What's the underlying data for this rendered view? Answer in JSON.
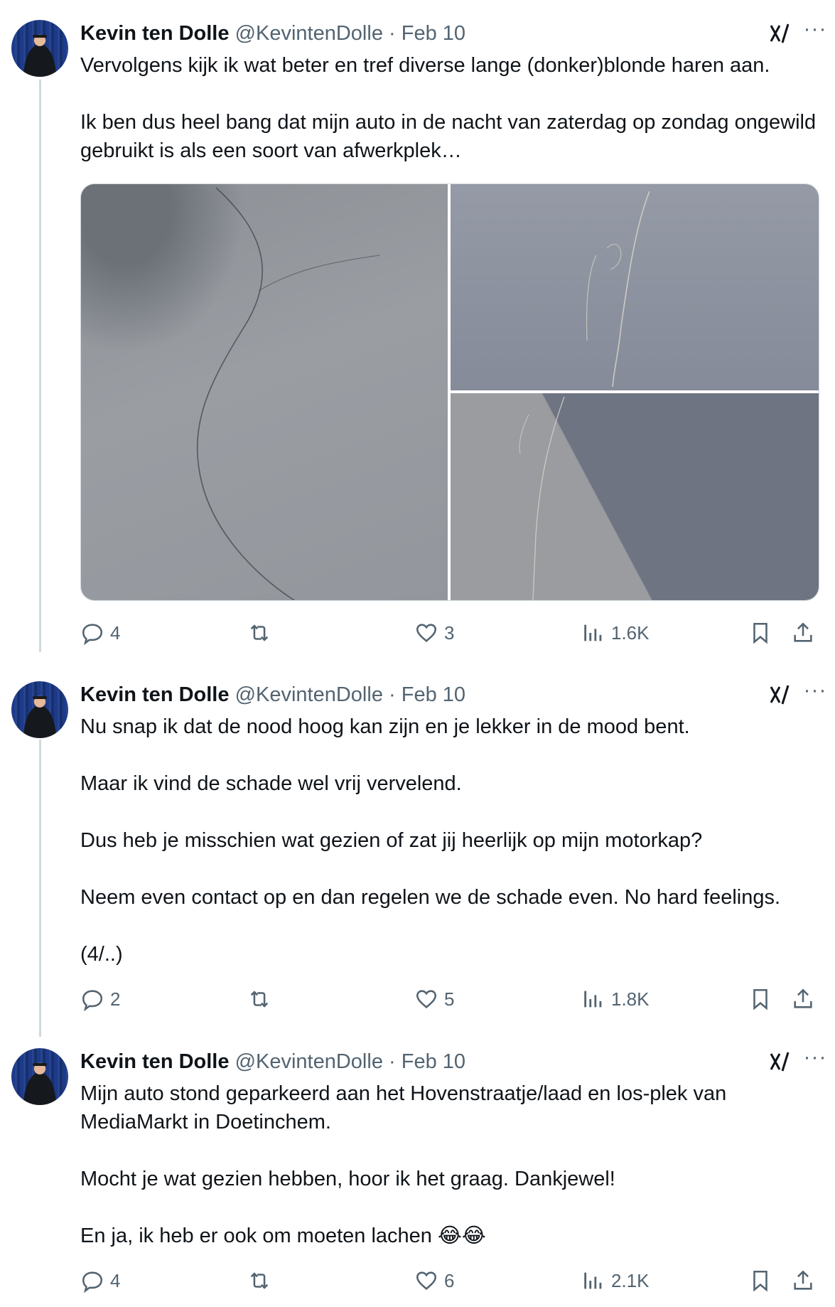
{
  "tweets": [
    {
      "author": {
        "name": "Kevin ten Dolle",
        "handle": "@KevintenDolle",
        "separator": "·",
        "date": "Feb 10"
      },
      "paragraphs": [
        "Vervolgens kijk ik wat beter en tref diverse lange (donker)blonde haren aan.",
        "Ik ben dus heel bang dat mijn auto in de nacht van zaterdag op zondag ongewild gebruikt is als een soort van afwerkplek…"
      ],
      "actions": {
        "replies": "4",
        "retweets": "",
        "likes": "3",
        "views": "1.6K"
      }
    },
    {
      "author": {
        "name": "Kevin ten Dolle",
        "handle": "@KevintenDolle",
        "separator": "·",
        "date": "Feb 10"
      },
      "paragraphs": [
        "Nu snap ik dat de nood hoog kan zijn en je lekker in de mood bent.",
        "Maar ik vind de schade wel vrij vervelend.",
        "Dus heb je misschien wat gezien of zat jij heerlijk op mijn motorkap?",
        "Neem even contact op en dan regelen we de schade even. No hard feelings.",
        "(4/..)"
      ],
      "actions": {
        "replies": "2",
        "retweets": "",
        "likes": "5",
        "views": "1.8K"
      }
    },
    {
      "author": {
        "name": "Kevin ten Dolle",
        "handle": "@KevintenDolle",
        "separator": "·",
        "date": "Feb 10"
      },
      "paragraphs": [
        "Mijn auto stond geparkeerd aan het Hovenstraatje/laad en los-plek van MediaMarkt in Doetinchem.",
        "Mocht je wat gezien hebben, hoor ik het graag. Dankjewel!",
        "En ja, ik heb er ook om moeten lachen 😂😂"
      ],
      "actions": {
        "replies": "4",
        "retweets": "",
        "likes": "6",
        "views": "2.1K"
      }
    }
  ],
  "more_glyph": "···",
  "icons": [
    "reply-icon",
    "retweet-icon",
    "like-icon",
    "views-icon",
    "bookmark-icon",
    "share-icon",
    "grok-icon",
    "more-icon"
  ],
  "colors": {
    "text": "#0f1419",
    "secondary": "#536471",
    "thread_line": "#cfd9de"
  }
}
